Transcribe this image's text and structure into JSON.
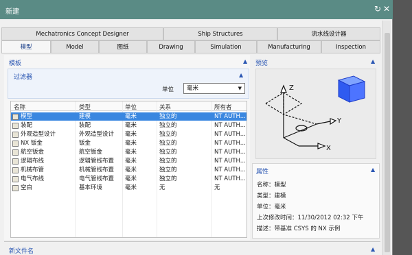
{
  "window": {
    "title": "新建"
  },
  "tabs_row1": [
    {
      "label": "Mechatronics Concept Designer"
    },
    {
      "label": "Ship Structures"
    },
    {
      "label": "流水线设计器"
    }
  ],
  "tabs_row2": [
    {
      "label": "模型",
      "active": true
    },
    {
      "label": "Model"
    },
    {
      "label": "图纸"
    },
    {
      "label": "Drawing"
    },
    {
      "label": "Simulation"
    },
    {
      "label": "Manufacturing"
    },
    {
      "label": "Inspection"
    }
  ],
  "templates": {
    "title": "模板",
    "filter": {
      "title": "过滤器",
      "unit_label": "单位",
      "unit_value": "毫米"
    },
    "columns": [
      "名称",
      "类型",
      "单位",
      "关系",
      "所有者"
    ],
    "rows": [
      [
        "模型",
        "建模",
        "毫米",
        "独立的",
        "NT AUTH..."
      ],
      [
        "装配",
        "装配",
        "毫米",
        "独立的",
        "NT AUTH..."
      ],
      [
        "外观造型设计",
        "外观造型设计",
        "毫米",
        "独立的",
        "NT AUTH..."
      ],
      [
        "NX 钣金",
        "钣金",
        "毫米",
        "独立的",
        "NT AUTH..."
      ],
      [
        "航空钣金",
        "航空钣金",
        "毫米",
        "独立的",
        "NT AUTH..."
      ],
      [
        "逻辑布线",
        "逻辑管线布置",
        "毫米",
        "独立的",
        "NT AUTH..."
      ],
      [
        "机械布管",
        "机械管线布置",
        "毫米",
        "独立的",
        "NT AUTH..."
      ],
      [
        "电气布线",
        "电气管线布置",
        "毫米",
        "独立的",
        "NT AUTH..."
      ],
      [
        "空白",
        "基本环境",
        "毫米",
        "无",
        "无"
      ]
    ]
  },
  "preview": {
    "title": "预览",
    "axes": {
      "x": "X",
      "y": "Y",
      "z": "Z"
    }
  },
  "properties": {
    "title": "属性",
    "name": "名称：模型",
    "type": "类型：建模",
    "unit": "单位：毫米",
    "modified": "上次修改时间：11/30/2012 02:32 下午",
    "description": "描述：带基准 CSYS 的 NX 示例"
  },
  "new_file": {
    "title": "新文件名"
  },
  "colors": {
    "titlebar": "#5a8b85",
    "accent": "#2b57b3",
    "selection": "#3a87e0"
  }
}
